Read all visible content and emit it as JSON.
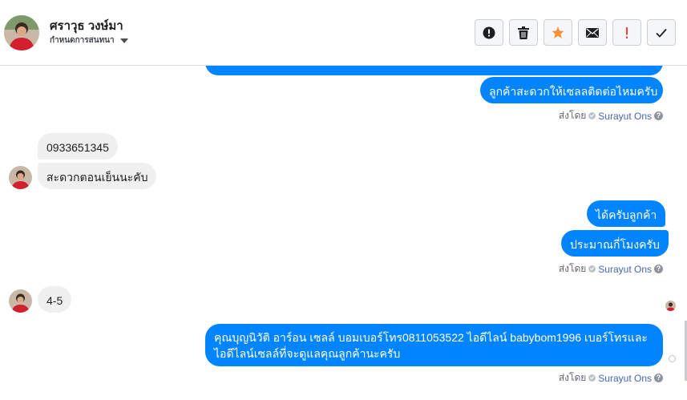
{
  "header": {
    "name": "ศราวุธ วงษ์มา",
    "subtitle": "กำหนดการสนทนา",
    "actions": [
      {
        "icon": "alert-circle-icon",
        "label": "Mark as spam"
      },
      {
        "icon": "trash-icon",
        "label": "Delete"
      },
      {
        "icon": "star-icon",
        "label": "Star",
        "color": "#f7923b"
      },
      {
        "icon": "envelope-icon",
        "label": "Mark as unread"
      },
      {
        "icon": "exclamation-icon",
        "label": "Follow up",
        "color": "#fa3e3e"
      },
      {
        "icon": "checkmark-icon",
        "label": "Done"
      }
    ]
  },
  "messages": {
    "out1_partial": "",
    "out2": "ลูกค้าสะดวกให้เซลลติดต่อไหมครับ",
    "in1": "0933651345",
    "in2": "สะดวกตอนเย็นนะคับ",
    "out3": "ได้ครับลูกค้า",
    "out4": "ประมาณกี่โมงครับ",
    "in3": "4-5",
    "out5_line1": "คุณบุญนิวัติ อาร์อน เซลล์ บอมเบอร์โทร0811053522 ไอดีไลน์ babybom1996  เบอร์โทรและ",
    "out5_line2": "ไอดีไลน์เซลล์ที่จะดูแลคุณลูกค้านะครับ"
  },
  "sent_by": {
    "prefix": "ส่งโดย",
    "name": "Surayut Ons",
    "help": "?"
  },
  "colors": {
    "outgoing": "#0084ff",
    "incoming": "#f1f0f0",
    "link": "#4267b2"
  }
}
